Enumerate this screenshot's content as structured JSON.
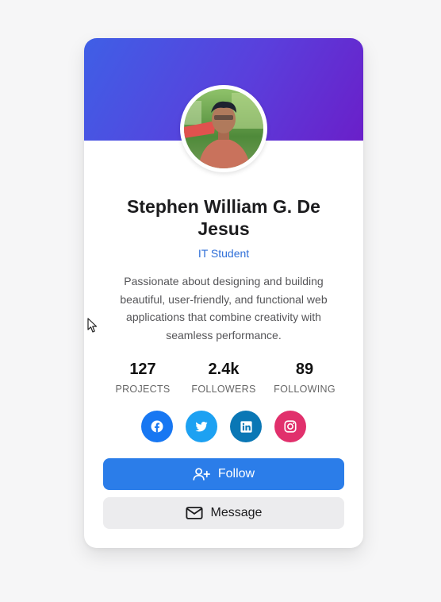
{
  "profile": {
    "name": "Stephen William G. De Jesus",
    "role": "IT Student",
    "bio": "Passionate about designing and building beautiful, user-friendly, and functional web applications that combine creativity with seamless performance."
  },
  "stats": [
    {
      "value": "127",
      "label": "PROJECTS"
    },
    {
      "value": "2.4k",
      "label": "FOLLOWERS"
    },
    {
      "value": "89",
      "label": "FOLLOWING"
    }
  ],
  "socials": [
    {
      "icon": "facebook-icon",
      "color": "#1877f2"
    },
    {
      "icon": "twitter-icon",
      "color": "#1da1f2"
    },
    {
      "icon": "linkedin-icon",
      "color": "#0a77b5"
    },
    {
      "icon": "instagram-icon",
      "color": "#e1306c"
    }
  ],
  "actions": {
    "follow_label": "Follow",
    "message_label": "Message"
  },
  "colors": {
    "banner_start": "#3f5fe6",
    "banner_end": "#6a1fc9",
    "accent": "#2b7de9",
    "role_text": "#2f6fd8"
  }
}
